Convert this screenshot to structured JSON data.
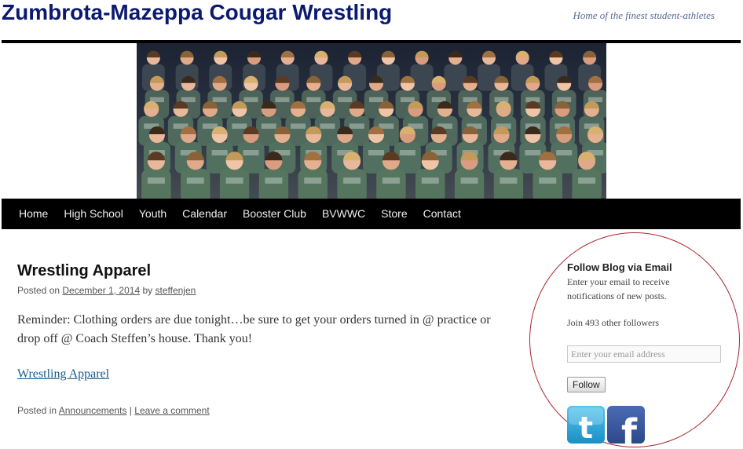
{
  "site": {
    "title": "Zumbrota-Mazeppa Cougar Wrestling",
    "tagline": "Home of the finest student-athletes"
  },
  "nav": {
    "items": [
      "Home",
      "High School",
      "Youth",
      "Calendar",
      "Booster Club",
      "BVWWC",
      "Store",
      "Contact"
    ]
  },
  "post": {
    "title": "Wrestling Apparel",
    "meta_prefix": "Posted on",
    "date": "December 1, 2014",
    "by": "by",
    "author": "steffenjen",
    "body": "Reminder: Clothing orders are due tonight…be sure to get your orders turned in @ practice or drop off @ Coach Steffen’s house. Thank you!",
    "link": "Wrestling Apparel",
    "footer_prefix": "Posted in",
    "category": "Announcements",
    "separator": "|",
    "comment_link": "Leave a comment"
  },
  "widget": {
    "title": "Follow Blog via Email",
    "description": "Enter your email to receive notifications of new posts.",
    "followers": "Join 493 other followers",
    "email_placeholder": "Enter your email address",
    "button": "Follow"
  },
  "social": {
    "twitter_icon": "twitter-icon",
    "facebook_icon": "facebook-icon"
  },
  "colors": {
    "title": "#0b1a6e",
    "nav_bg": "#000000",
    "link": "#1b5b8c",
    "circle": "#a8262c"
  }
}
